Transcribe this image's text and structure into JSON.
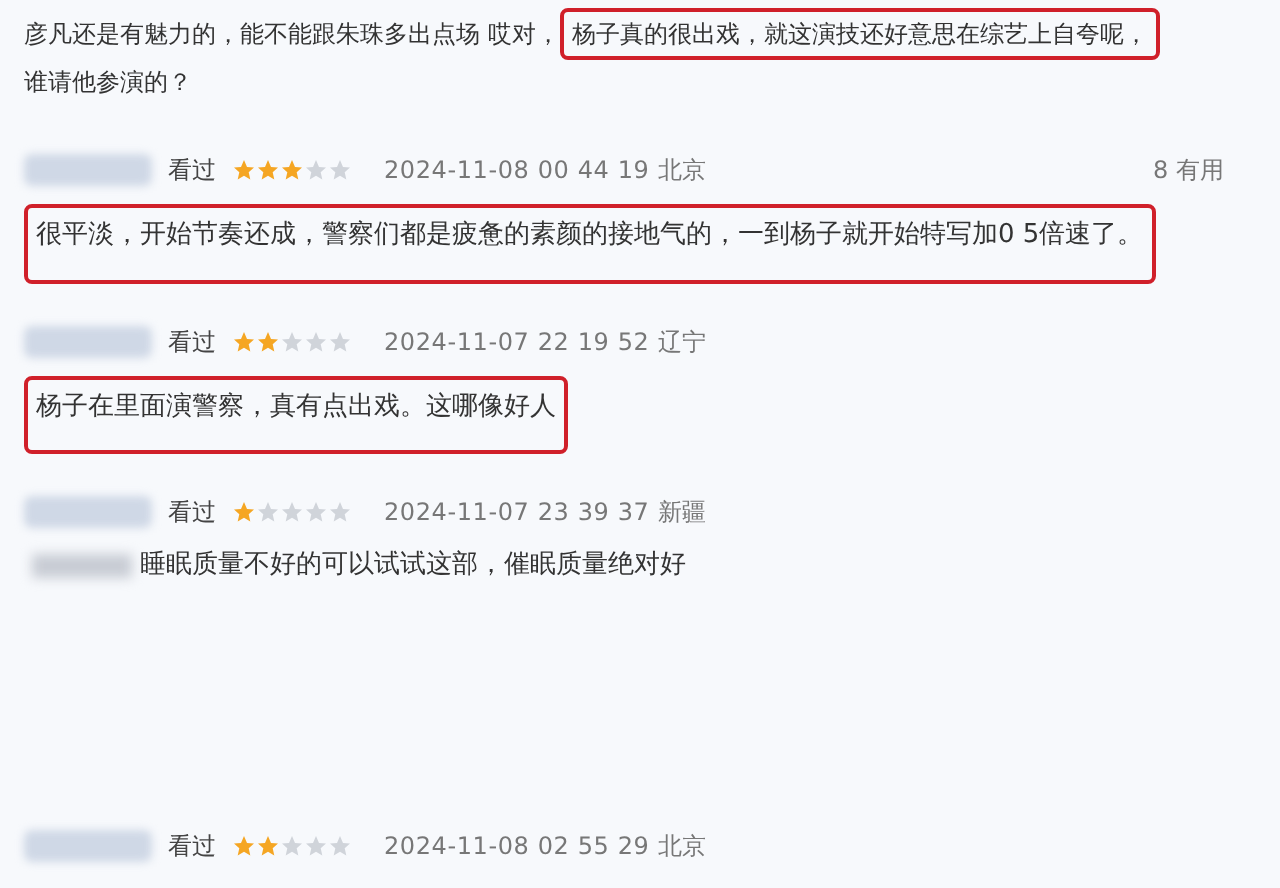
{
  "comments": [
    {
      "kind": "body_only",
      "parts": [
        {
          "text": "彦凡还是有魅力的，能不能跟朱珠多出点场 哎对，",
          "highlighted": false
        },
        {
          "text": "杨子真的很出戏，就这演技还好意思在综艺上自夸呢，",
          "highlighted": true
        },
        {
          "text": "谁请他参演的？",
          "highlighted": false
        }
      ]
    },
    {
      "kind": "full",
      "status": "看过",
      "stars": 3,
      "time": "2024-11-08 00 44 19 北京",
      "useful": "8 有用",
      "highlighted": true,
      "redacted_prefix": false,
      "text": "很平淡，开始节奏还成，警察们都是疲惫的素颜的接地气的，一到杨子就开始特写加0 5倍速了。"
    },
    {
      "kind": "full",
      "status": "看过",
      "stars": 2,
      "time": "2024-11-07 22 19 52 辽宁",
      "highlighted": true,
      "redacted_prefix": false,
      "text": "杨子在里面演警察，真有点出戏。这哪像好人"
    },
    {
      "kind": "full",
      "status": "看过",
      "stars": 1,
      "time": "2024-11-07 23 39 37 新疆",
      "highlighted": false,
      "redacted_prefix": true,
      "text": "睡眠质量不好的可以试试这部，催眠质量绝对好"
    },
    {
      "kind": "header_only",
      "status": "看过",
      "stars": 2,
      "time": "2024-11-08 02 55 29 北京"
    }
  ]
}
